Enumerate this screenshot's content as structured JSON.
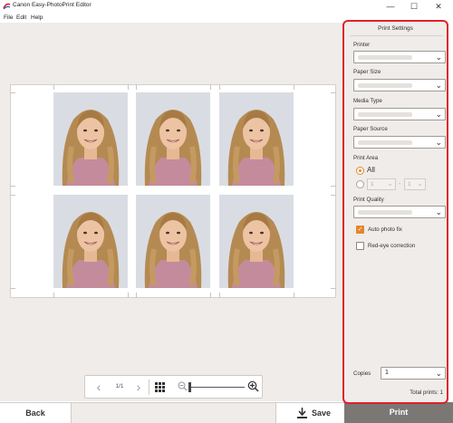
{
  "window": {
    "title": "Canon Easy-PhotoPrint Editor",
    "minimize_glyph": "—",
    "maximize_glyph": "☐",
    "close_glyph": "✕"
  },
  "menu": [
    "File",
    "Edit",
    "Help"
  ],
  "preview": {
    "page_indicator": "1/1",
    "photo_count": 6,
    "photo_subject": "girl-portrait"
  },
  "toolbar": {
    "prev_glyph": "‹",
    "next_glyph": "›",
    "zoom_level": 0.1
  },
  "bottom": {
    "back_label": "Back",
    "save_label": "Save",
    "print_label": "Print"
  },
  "panel": {
    "title": "Print Settings",
    "printer_label": "Printer",
    "paper_size_label": "Paper Size",
    "media_type_label": "Media Type",
    "paper_source_label": "Paper Source",
    "print_area_label": "Print Area",
    "print_area_all": "All",
    "range_from": "1",
    "range_dash": "-",
    "range_to": "1",
    "print_quality_label": "Print Quality",
    "auto_photo_fix_label": "Auto photo fix",
    "auto_photo_fix_checked": true,
    "red_eye_label": "Red-eye correction",
    "red_eye_checked": false,
    "copies_label": "Copies",
    "copies_value": "1",
    "total_prints": "Total prints: 1",
    "chevron_glyph": "⌄"
  },
  "colors": {
    "accent": "#e5862b",
    "highlight_border": "#e0202a",
    "print_button": "#7a7774",
    "background": "#efece9"
  }
}
